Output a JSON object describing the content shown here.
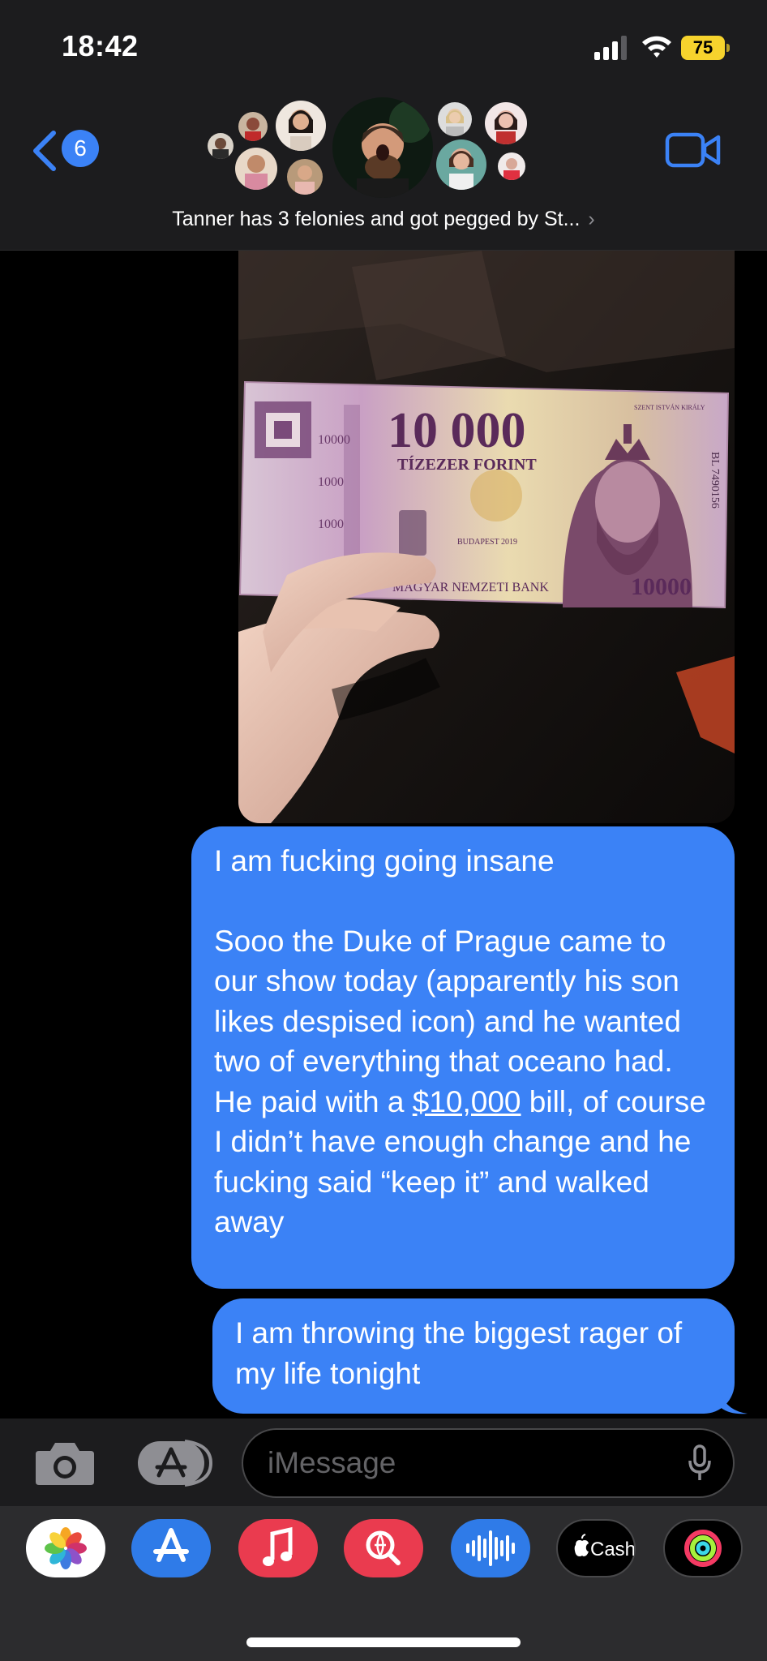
{
  "status": {
    "time": "18:42",
    "battery": "75"
  },
  "header": {
    "back_count": "6",
    "group_name": "Tanner has 3 felonies and got pegged by St...",
    "chevron": "›"
  },
  "banknote": {
    "amount": "10 000",
    "words": "TÍZEZER FORINT",
    "bank": "MAGYAR NEMZETI BANK",
    "city": "BUDAPEST 2019",
    "serial": "BL 7490156",
    "small_amount": "10000",
    "king": "SZENT ISTVÁN KIRÁLY"
  },
  "messages": {
    "m1_line1": "I am fucking going insane",
    "m1_part1": "Sooo the Duke of Prague came to our show today (apparently his son likes despised icon) and he wanted two of everything that oceano had. He paid with a ",
    "m1_link": "$10,000",
    "m1_part2": " bill, of course I didn’t have enough change and he fucking said “keep it” and walked away",
    "m2": "I am throwing the biggest rager of my life tonight"
  },
  "compose": {
    "placeholder": "iMessage"
  },
  "dock": {
    "apps": [
      "photos-icon",
      "app-store-icon",
      "music-icon",
      "images-search-icon",
      "audio-message-icon",
      "apple-cash-icon",
      "fitness-icon"
    ],
    "cash_label": "Cash"
  },
  "colors": {
    "bubble": "#3b82f6",
    "accent": "#3b82f6",
    "bar": "#1c1c1e",
    "dock": "#2c2c2e"
  }
}
